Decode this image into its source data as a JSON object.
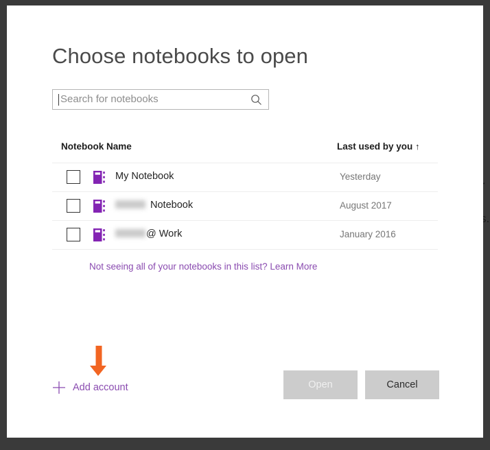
{
  "dialog": {
    "title": "Choose notebooks to open"
  },
  "search": {
    "placeholder": "Search for notebooks",
    "value": "",
    "icon": "search-icon"
  },
  "table": {
    "columns": {
      "name": "Notebook Name",
      "date": "Last used by you",
      "sort_indicator": "↑"
    },
    "rows": [
      {
        "icon": "notebook-icon",
        "checked": false,
        "name_prefix": "",
        "name": "My Notebook",
        "redacted": false,
        "date": "Yesterday"
      },
      {
        "icon": "notebook-icon",
        "checked": false,
        "name_prefix": "",
        "name": "Notebook",
        "redacted": true,
        "date": "August 2017"
      },
      {
        "icon": "notebook-icon",
        "checked": false,
        "name_prefix": "",
        "name": "@ Work",
        "redacted": true,
        "date": "January 2016"
      }
    ]
  },
  "links": {
    "learn_more": "Not seeing all of your notebooks in this list? Learn More",
    "add_account": "Add account",
    "add_account_icon": "plus-icon"
  },
  "footer": {
    "open_label": "Open",
    "cancel_label": "Cancel"
  },
  "annotation": {
    "type": "arrow-down",
    "color": "#F26522",
    "points_to": "Add account"
  },
  "background": {
    "fragment_1": "r",
    "fragment_2": "s."
  },
  "colors": {
    "accent_purple": "#8a4bb0",
    "notebook_icon": "#8324b3",
    "backdrop": "#3a3a3a",
    "annotation_orange": "#F26522",
    "button_gray": "#cccccc"
  }
}
